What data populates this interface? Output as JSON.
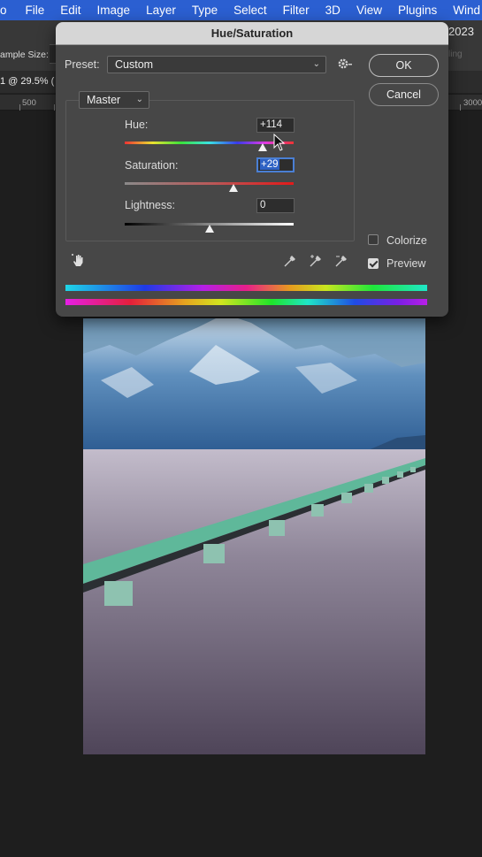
{
  "menubar": {
    "app_fragment": "o",
    "items": [
      "File",
      "Edit",
      "Image",
      "Layer",
      "Type",
      "Select",
      "Filter",
      "3D",
      "View",
      "Plugins",
      "Wind"
    ]
  },
  "options_bar": {
    "sample_size_label": "ample Size:",
    "year": "2023",
    "faded_text": "ling"
  },
  "document": {
    "tab_label": "1 @ 29.5% ("
  },
  "ruler": {
    "left_label": "500",
    "right_label": "3000"
  },
  "dialog": {
    "title": "Hue/Saturation",
    "preset_label": "Preset:",
    "preset_value": "Custom",
    "channel_value": "Master",
    "ok_label": "OK",
    "cancel_label": "Cancel",
    "hue_label": "Hue:",
    "hue_value": "+114",
    "saturation_label": "Saturation:",
    "saturation_value": "+29",
    "lightness_label": "Lightness:",
    "lightness_value": "0",
    "colorize_label": "Colorize",
    "colorize_checked": false,
    "preview_label": "Preview",
    "preview_checked": true,
    "icons": [
      "gear-icon",
      "targeted-adjustment-hand-icon",
      "eyedropper-icon",
      "eyedropper-plus-icon",
      "eyedropper-minus-icon"
    ]
  },
  "sliders": {
    "hue": {
      "min": -180,
      "max": 180,
      "value": 114
    },
    "saturation": {
      "min": -100,
      "max": 100,
      "value": 29
    },
    "lightness": {
      "min": -100,
      "max": 100,
      "value": 0
    }
  },
  "colors": {
    "menubar": "#2b5fd1",
    "dialog_bg": "#474747",
    "focus": "#4a7fd4"
  }
}
